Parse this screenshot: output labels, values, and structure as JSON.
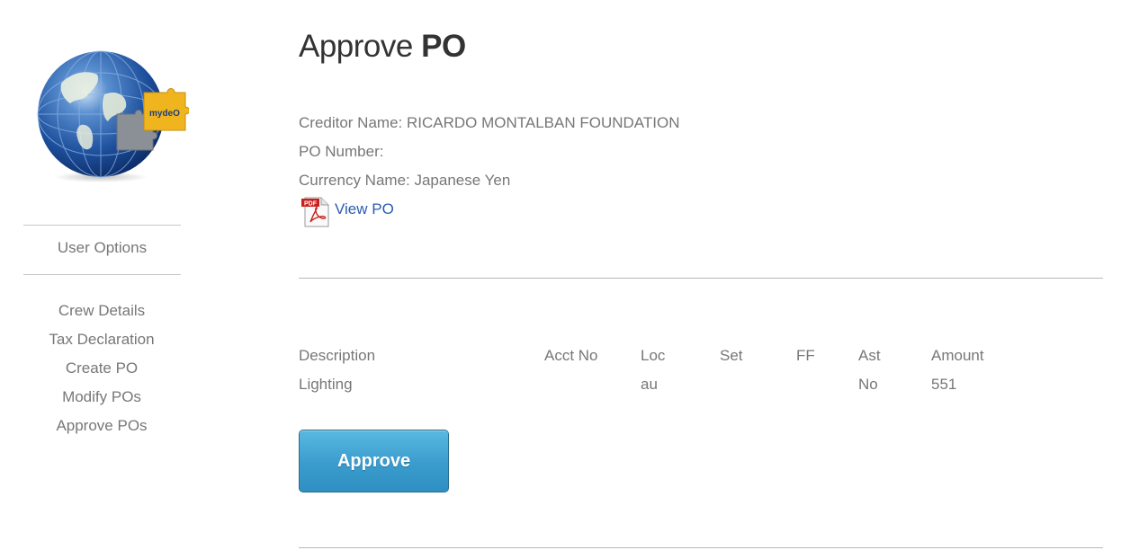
{
  "sidebar": {
    "logo_alt": "mydeO globe logo",
    "logo_text": "mydeO",
    "heading": "User Options",
    "items": [
      {
        "label": "Crew Details"
      },
      {
        "label": "Tax Declaration"
      },
      {
        "label": "Create PO"
      },
      {
        "label": "Modify POs"
      },
      {
        "label": "Approve POs"
      }
    ]
  },
  "page": {
    "title_prefix": "Approve",
    "title_bold": "PO"
  },
  "info": {
    "creditor": "Creditor Name: RICARDO MONTALBAN FOUNDATION",
    "po_number": "PO Number:",
    "currency": "Currency Name: Japanese Yen",
    "view_po": "View PO",
    "pdf_icon_label": "PDF"
  },
  "table": {
    "headers": [
      "Description",
      "Acct No",
      "Loc",
      "Set",
      "FF",
      "Ast",
      "Amount"
    ],
    "rows": [
      [
        "Lighting",
        "",
        "au",
        "",
        "",
        "No",
        "551"
      ]
    ]
  },
  "actions": {
    "approve_label": "Approve"
  },
  "colors": {
    "link": "#2a5db0",
    "button": "#3a9ccd",
    "text": "#777777",
    "title": "#333333"
  }
}
